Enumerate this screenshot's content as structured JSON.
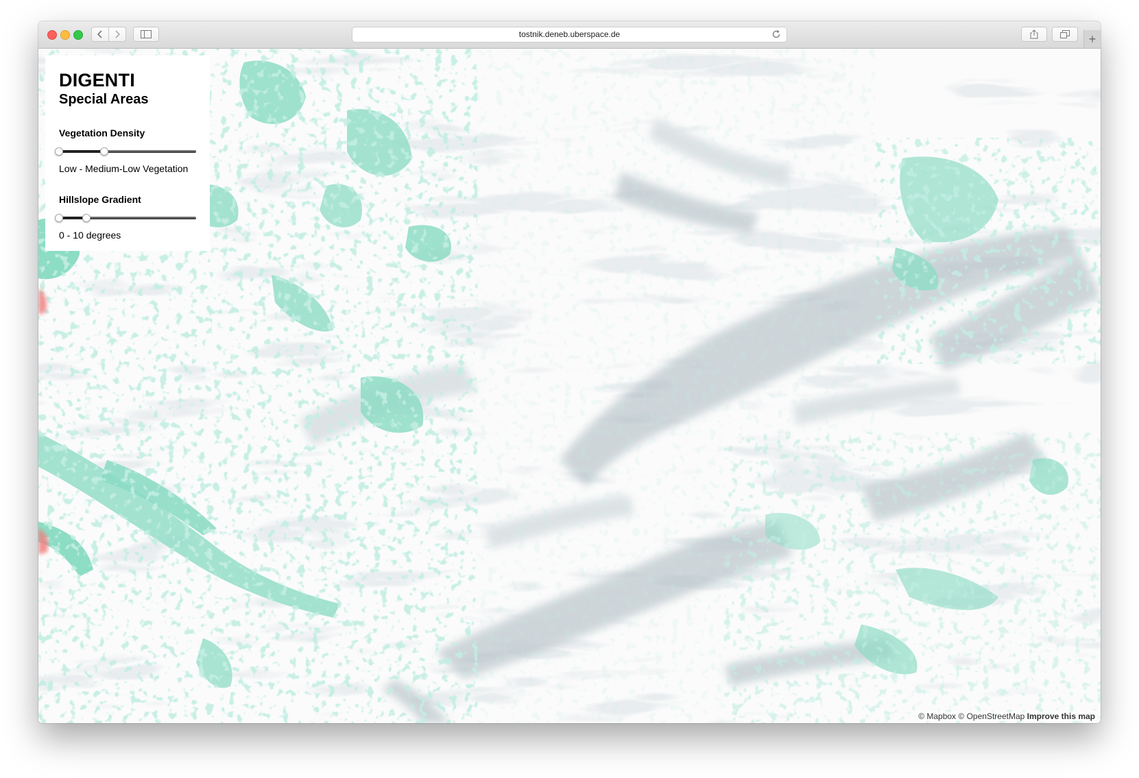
{
  "browser": {
    "url": "tostnik.deneb.uberspace.de",
    "newtab_symbol": "+"
  },
  "panel": {
    "title": "DIGENTI",
    "subtitle": "Special Areas",
    "vegetation": {
      "label": "Vegetation Density",
      "value_text": "Low - Medium-Low Vegetation",
      "range_fraction": [
        0.0,
        0.33
      ]
    },
    "hillslope": {
      "label": "Hillslope Gradient",
      "value_text": "0 - 10 degrees",
      "range_fraction": [
        0.0,
        0.2
      ]
    }
  },
  "attribution": {
    "mapbox": "© Mapbox",
    "osm": "© OpenStreetMap",
    "improve": "Improve this map"
  },
  "colors": {
    "vegetation": "#8ddcc4",
    "shade": "#b7c3c9",
    "contour": "#c5cccf"
  }
}
